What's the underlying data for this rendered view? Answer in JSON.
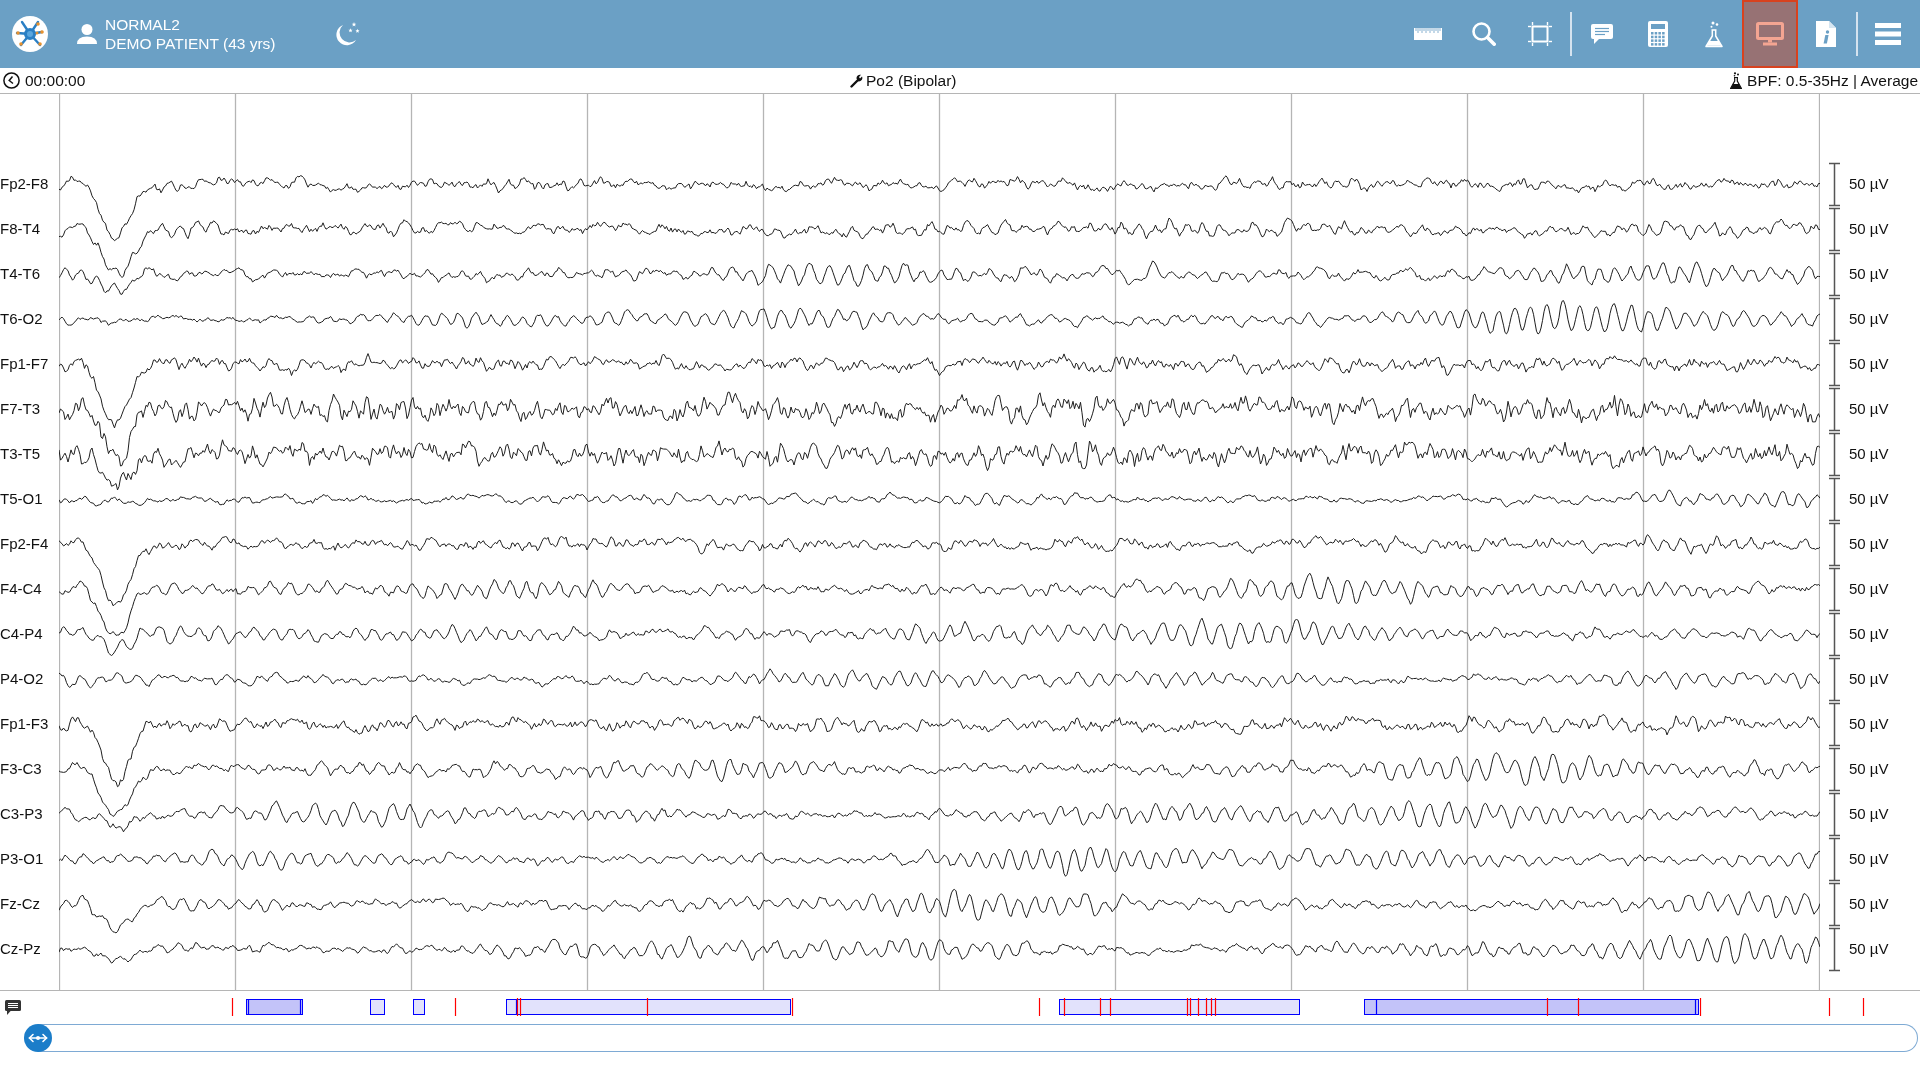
{
  "header": {
    "recording": "NORMAL2",
    "patient": "DEMO PATIENT (43 yrs)"
  },
  "toolbar_groups": [
    {
      "buttons": [
        {
          "kind": "measure",
          "selected": false
        },
        {
          "kind": "zoom",
          "selected": false
        },
        {
          "kind": "select",
          "selected": false
        }
      ]
    },
    {
      "buttons": [
        {
          "kind": "comment",
          "selected": false
        },
        {
          "kind": "calculator",
          "selected": false
        },
        {
          "kind": "filter",
          "selected": false
        },
        {
          "kind": "display",
          "selected": true
        },
        {
          "kind": "info",
          "selected": false
        }
      ]
    },
    {
      "buttons": [
        {
          "kind": "menu",
          "selected": false
        }
      ]
    }
  ],
  "info_bar": {
    "time": "00:00:00",
    "montage": "Po2 (Bipolar)",
    "filter": "BPF: 0.5-35Hz | Average"
  },
  "channels": [
    {
      "label": "Fp2-F8",
      "scale": "50 µV"
    },
    {
      "label": "F8-T4",
      "scale": "50 µV"
    },
    {
      "label": "T4-T6",
      "scale": "50 µV"
    },
    {
      "label": "T6-O2",
      "scale": "50 µV"
    },
    {
      "label": "Fp1-F7",
      "scale": "50 µV"
    },
    {
      "label": "F7-T3",
      "scale": "50 µV"
    },
    {
      "label": "T3-T5",
      "scale": "50 µV"
    },
    {
      "label": "T5-O1",
      "scale": "50 µV"
    },
    {
      "label": "Fp2-F4",
      "scale": "50 µV"
    },
    {
      "label": "F4-C4",
      "scale": "50 µV"
    },
    {
      "label": "C4-P4",
      "scale": "50 µV"
    },
    {
      "label": "P4-O2",
      "scale": "50 µV"
    },
    {
      "label": "Fp1-F3",
      "scale": "50 µV"
    },
    {
      "label": "F3-C3",
      "scale": "50 µV"
    },
    {
      "label": "C3-P3",
      "scale": "50 µV"
    },
    {
      "label": "P3-O1",
      "scale": "50 µV"
    },
    {
      "label": "Fz-Cz",
      "scale": "50 µV"
    },
    {
      "label": "Cz-Pz",
      "scale": "50 µV"
    }
  ]
}
